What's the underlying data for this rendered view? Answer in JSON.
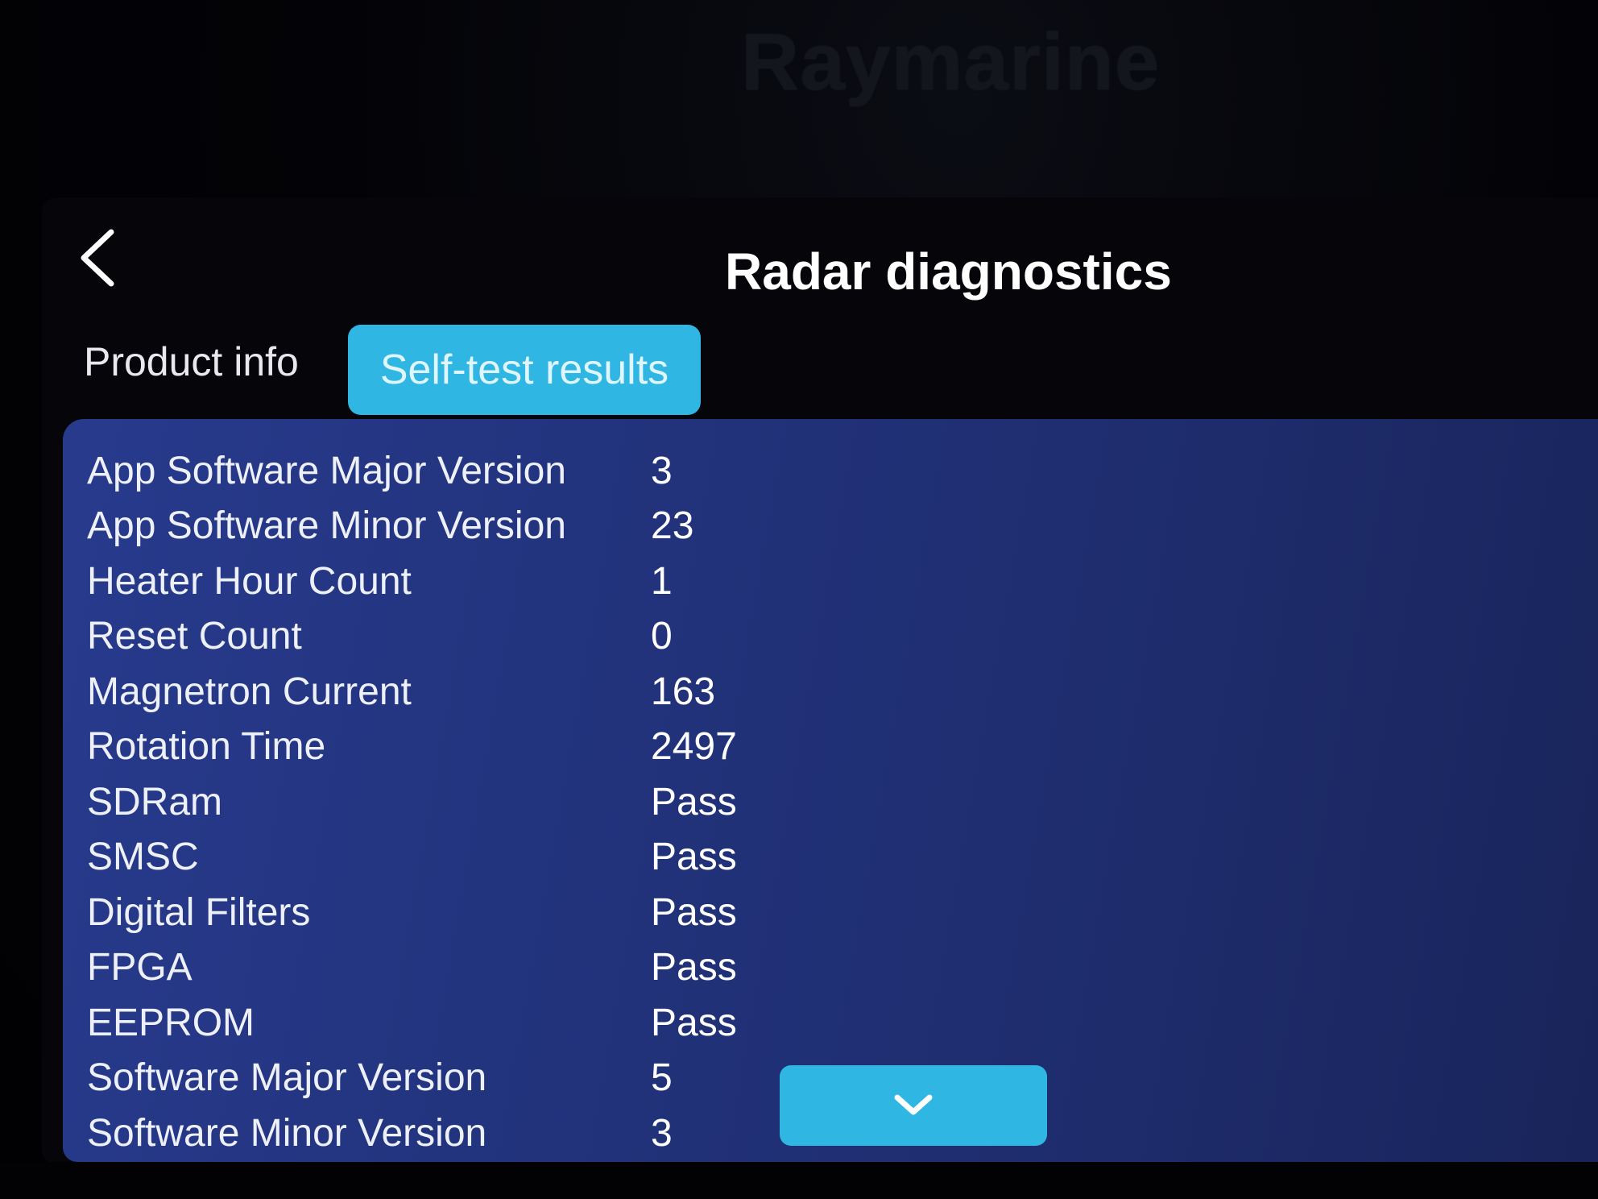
{
  "brand": "Raymarine",
  "header": {
    "title": "Radar diagnostics",
    "back_icon": "chevron-left-icon"
  },
  "tabs": [
    {
      "label": "Product info",
      "active": false
    },
    {
      "label": "Self-test results",
      "active": true
    }
  ],
  "rows": [
    {
      "label": "App Software Major Version",
      "value": "3"
    },
    {
      "label": "App Software Minor Version",
      "value": "23"
    },
    {
      "label": "Heater Hour Count",
      "value": "1"
    },
    {
      "label": "Reset Count",
      "value": "0"
    },
    {
      "label": "Magnetron Current",
      "value": "163"
    },
    {
      "label": "Rotation Time",
      "value": "2497"
    },
    {
      "label": "SDRam",
      "value": "Pass"
    },
    {
      "label": "SMSC",
      "value": "Pass"
    },
    {
      "label": "Digital Filters",
      "value": "Pass"
    },
    {
      "label": "FPGA",
      "value": "Pass"
    },
    {
      "label": "EEPROM",
      "value": "Pass"
    },
    {
      "label": "Software Major Version",
      "value": "5"
    },
    {
      "label": "Software Minor Version",
      "value": "3"
    }
  ],
  "scroll_button": {
    "icon": "chevron-down-icon"
  },
  "colors": {
    "accent": "#2fb6e2",
    "panel": "#23347f",
    "background": "#05050a",
    "text": "#ffffff"
  }
}
